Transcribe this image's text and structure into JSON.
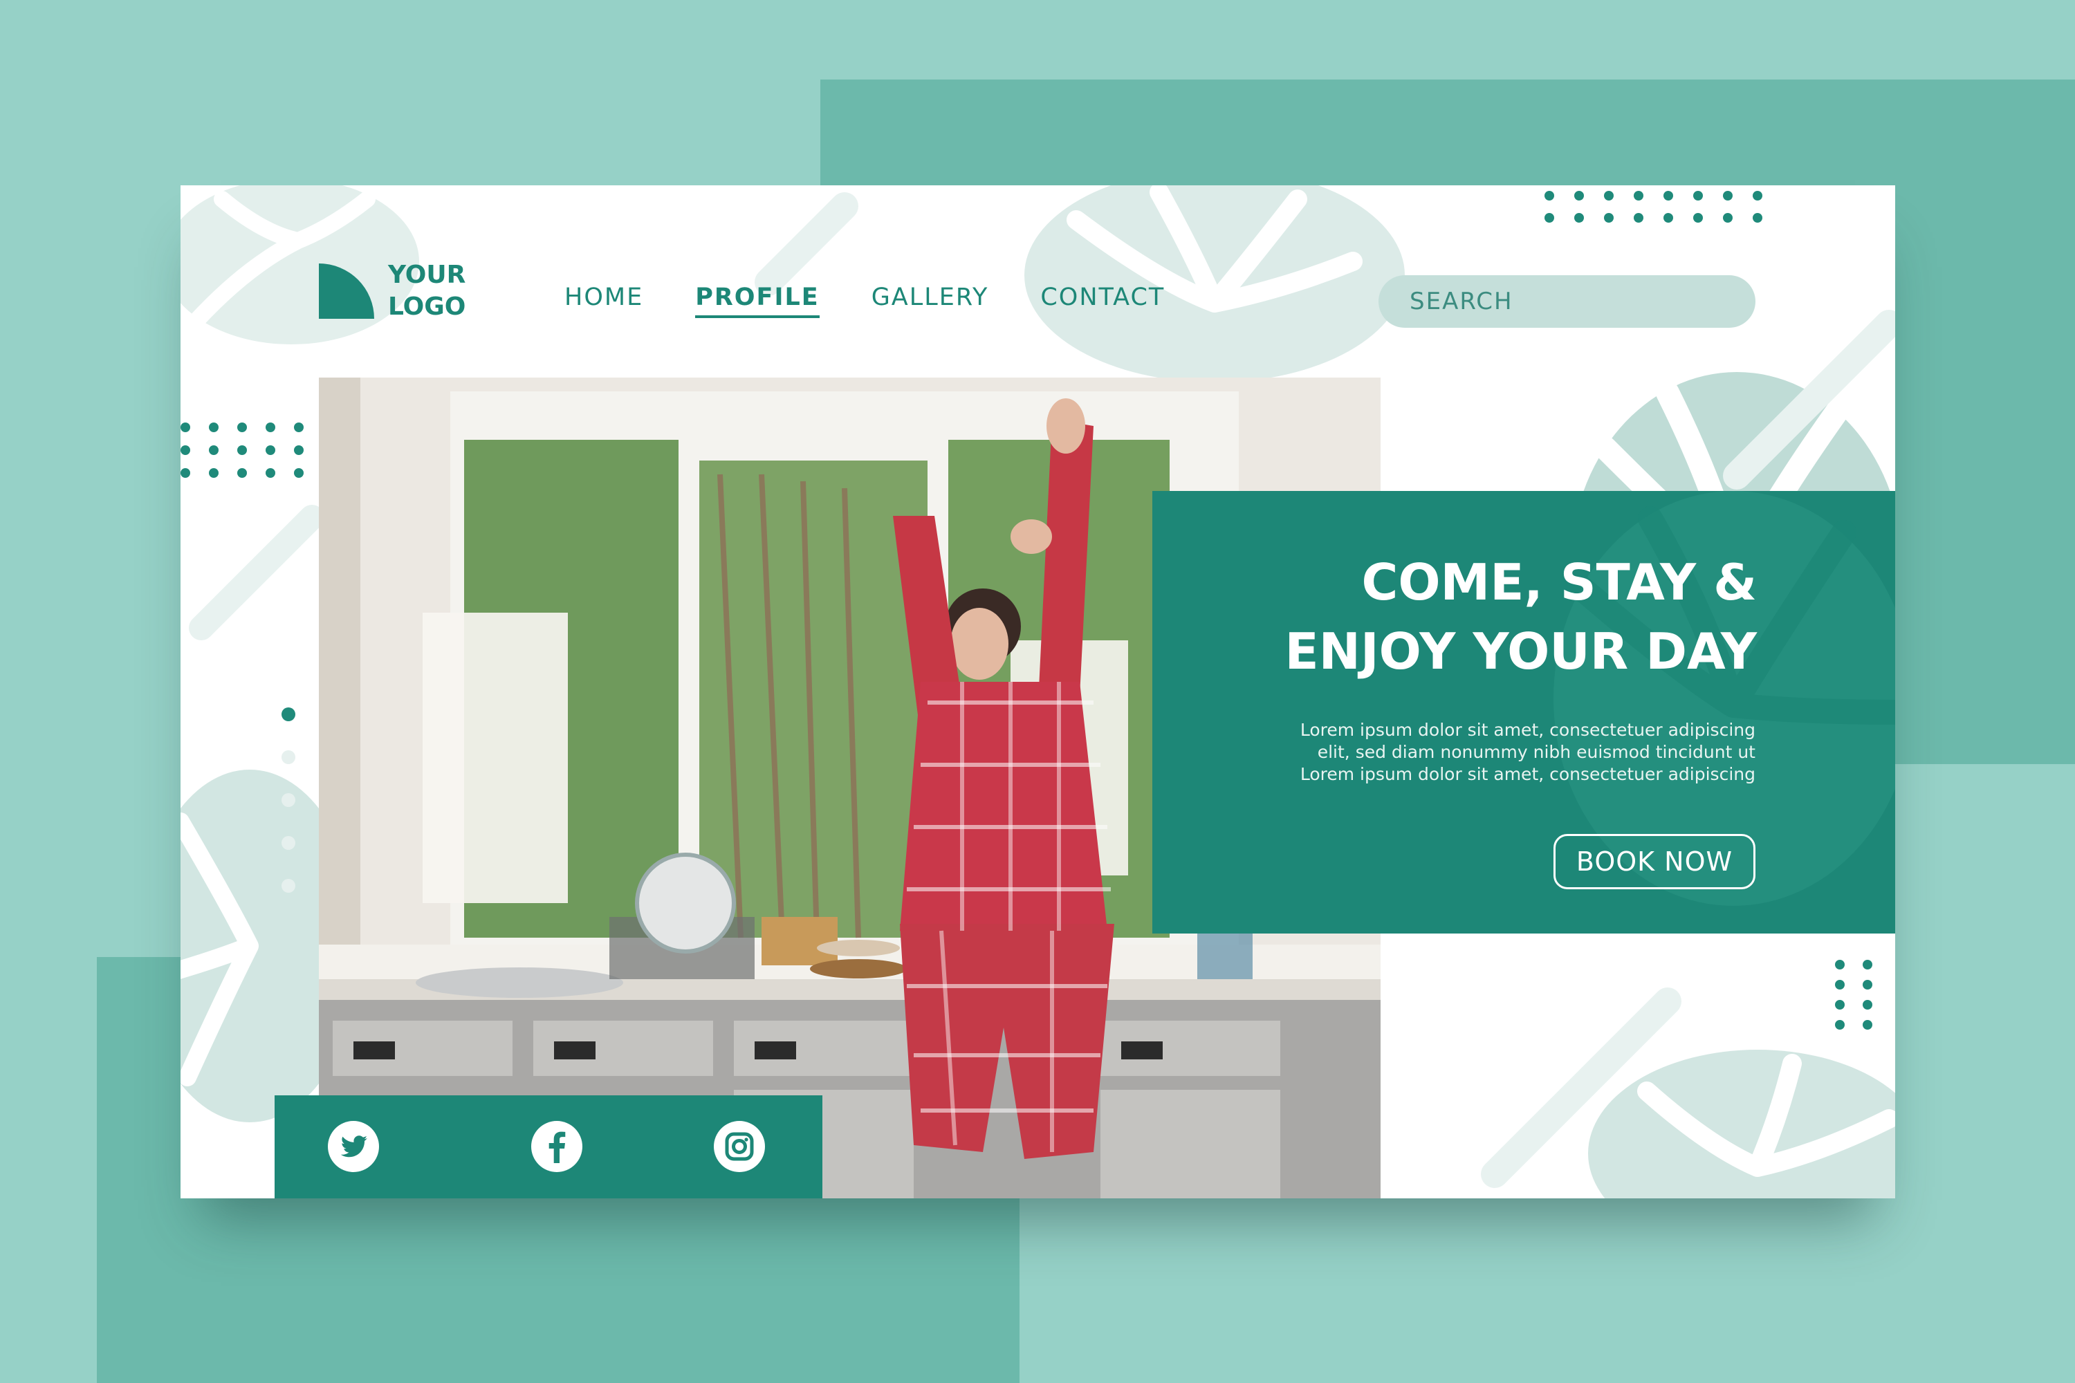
{
  "brand": {
    "logo_line1": "YOUR",
    "logo_line2": "LOGO"
  },
  "nav": {
    "items": [
      {
        "label": "HOME",
        "active": false
      },
      {
        "label": "PROFILE",
        "active": true
      },
      {
        "label": "GALLERY",
        "active": false
      },
      {
        "label": "CONTACT",
        "active": false
      }
    ]
  },
  "search": {
    "placeholder": "SEARCH"
  },
  "hero": {
    "title_line1": "COME, STAY &",
    "title_line2": "ENJOY YOUR DAY",
    "body_line1": "Lorem ipsum dolor sit amet, consectetuer adipiscing",
    "body_line2": "elit, sed diam nonummy nibh euismod tincidunt ut",
    "body_line3": "Lorem ipsum dolor sit amet, consectetuer adipiscing",
    "cta_label": "BOOK NOW"
  },
  "social": {
    "icons": [
      "twitter-icon",
      "facebook-icon",
      "instagram-icon"
    ]
  },
  "colors": {
    "background": "#96d1c7",
    "background_dark": "#6cb9ab",
    "brand": "#1d8777",
    "card": "#ffffff",
    "search_fill": "#c5dfda"
  }
}
